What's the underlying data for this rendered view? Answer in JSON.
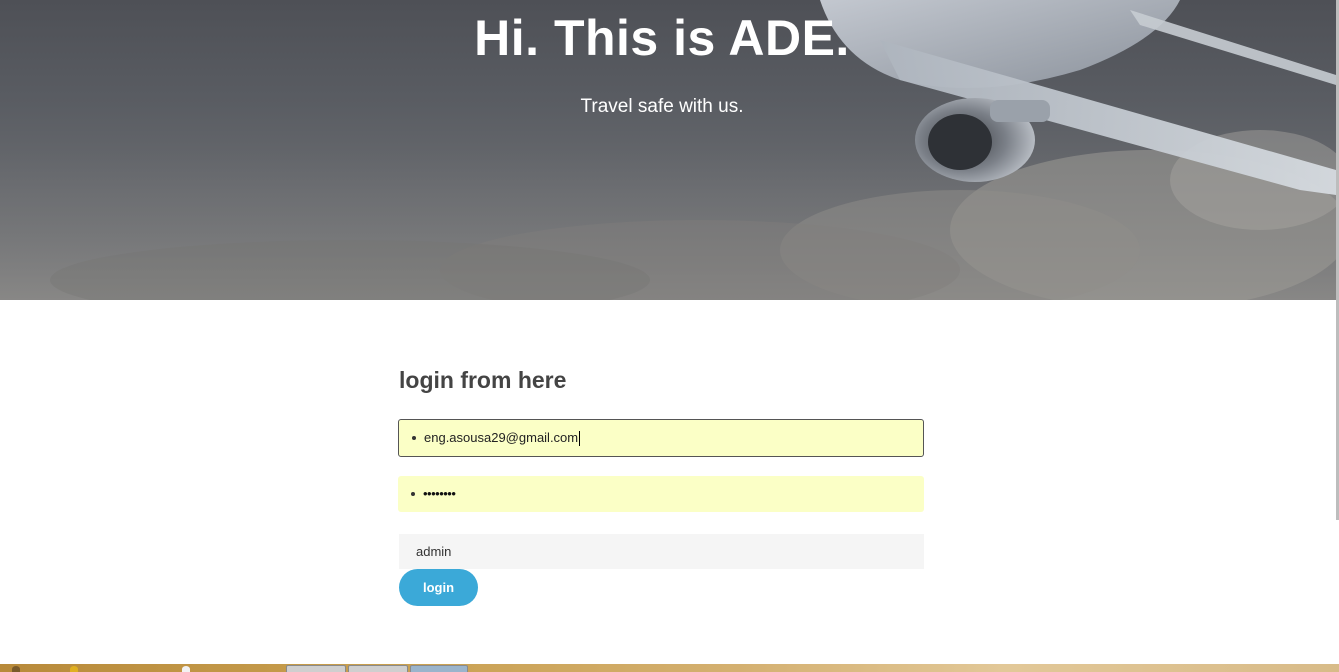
{
  "hero": {
    "title": "Hi. This is ADE.",
    "subtitle": "Travel safe with us."
  },
  "login": {
    "heading": "login from here",
    "email_value": "eng.asousa29@gmail.com",
    "password_mask": "••••••••",
    "role_value": "admin",
    "button_label": "login"
  },
  "colors": {
    "accent": "#3ba9d8",
    "autofill_background": "#fbffc6",
    "heading_text": "#444444"
  },
  "icons": {
    "field_marker": "bullet-icon",
    "hero_art": "airplane-icon"
  }
}
